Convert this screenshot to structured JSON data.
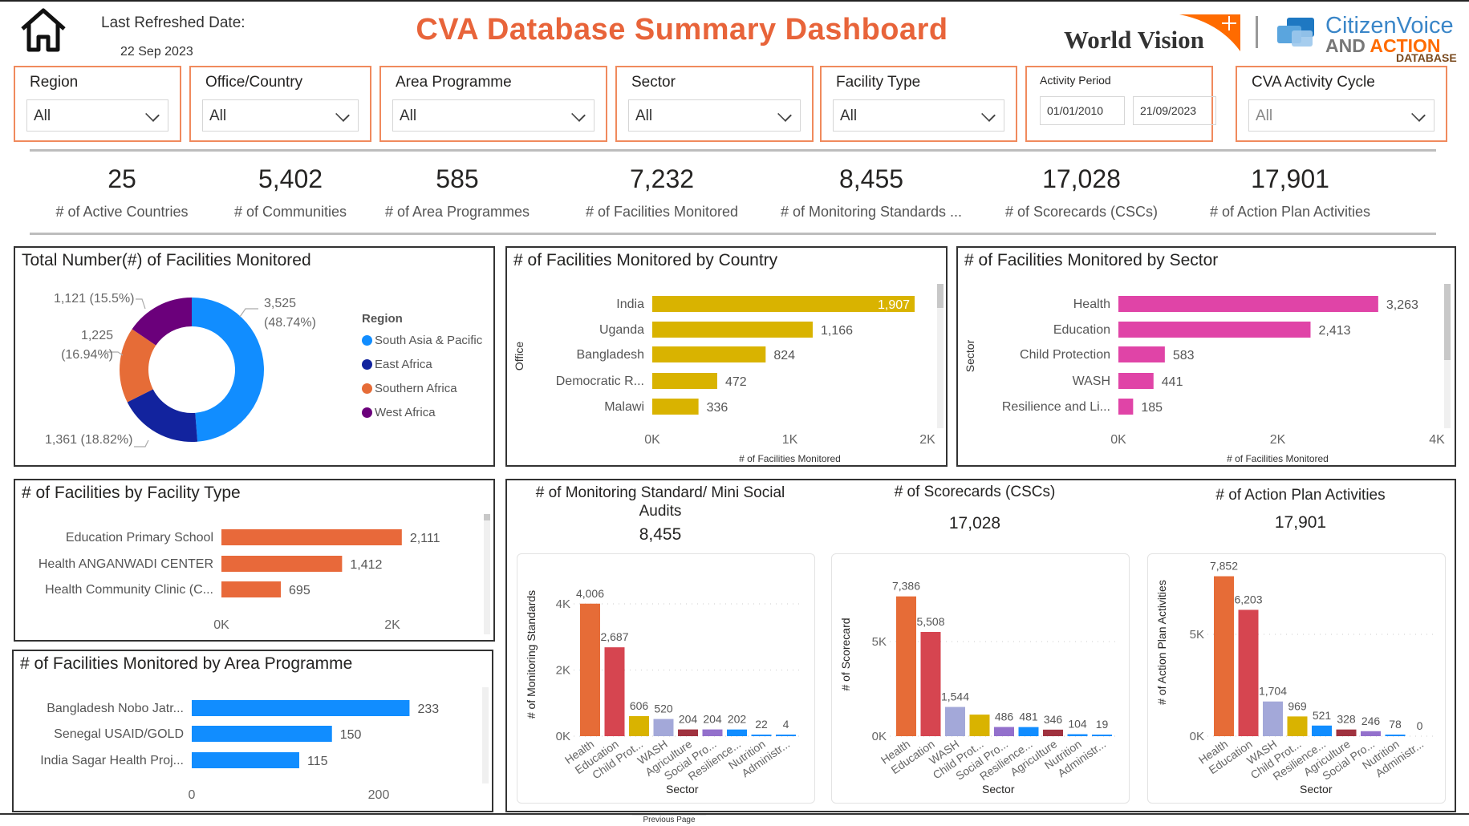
{
  "header": {
    "refresh_label": "Last Refreshed Date:",
    "refresh_date": "22 Sep 2023",
    "title": "CVA Database Summary Dashboard",
    "logo_wv": "World Vision",
    "logo_cva_1": "CitizenVoice",
    "logo_cva_2a": "AND ",
    "logo_cva_2b": "ACTION",
    "logo_cva_3": "DATABASE",
    "home_icon": "home-icon"
  },
  "filters": [
    {
      "label": "Region",
      "value": "All"
    },
    {
      "label": "Office/Country",
      "value": "All"
    },
    {
      "label": "Area Programme",
      "value": "All"
    },
    {
      "label": "Sector",
      "value": "All"
    },
    {
      "label": "Facility Type",
      "value": "All"
    }
  ],
  "activity_period": {
    "label": "Activity Period",
    "start": "01/01/2010",
    "end": "21/09/2023"
  },
  "cycle_filter": {
    "label": "CVA Activity Cycle",
    "value": "All"
  },
  "kpis": [
    {
      "value": "25",
      "label": "# of Active Countries"
    },
    {
      "value": "5,402",
      "label": "# of Communities"
    },
    {
      "value": "585",
      "label": "# of Area Programmes"
    },
    {
      "value": "7,232",
      "label": "# of Facilities Monitored"
    },
    {
      "value": "8,455",
      "label": "# of Monitoring Standards ..."
    },
    {
      "value": "17,028",
      "label": "# of Scorecards (CSCs)"
    },
    {
      "value": "17,901",
      "label": "# of Action Plan Activities"
    }
  ],
  "colors": {
    "accent": "#E8643A",
    "filter_border": "#F08A5D"
  },
  "footer": {
    "tab": "Previous Page"
  },
  "chart_data": [
    {
      "id": "donut",
      "type": "pie",
      "title": "Total Number(#) of Facilities Monitored",
      "legend_title": "Region",
      "legend_position": "right",
      "slices": [
        {
          "name": "South Asia & Pacific",
          "value": 3525,
          "pct": 48.74,
          "color": "#118DFF",
          "label1": "3,525",
          "label2": "(48.74%)"
        },
        {
          "name": "East Africa",
          "value": 1361,
          "pct": 18.82,
          "color": "#12239E",
          "label1": "1,361 (18.82%)",
          "label2": ""
        },
        {
          "name": "Southern Africa",
          "value": 1225,
          "pct": 16.94,
          "color": "#E66C37",
          "label1": "1,225",
          "label2": "(16.94%)"
        },
        {
          "name": "West Africa",
          "value": 1121,
          "pct": 15.5,
          "color": "#6B007B",
          "label1": "1,121 (15.5%)",
          "label2": ""
        }
      ]
    },
    {
      "id": "country",
      "type": "bar",
      "orientation": "horizontal",
      "title": "# of Facilities Monitored by Country",
      "ylabel": "Office",
      "xlabel": "# of Facilities Monitored",
      "categories": [
        "India",
        "Uganda",
        "Bangladesh",
        "Democratic R...",
        "Malawi"
      ],
      "values": [
        1907,
        1166,
        824,
        472,
        336
      ],
      "value_labels": [
        "1,907",
        "1,166",
        "824",
        "472",
        "336"
      ],
      "xlim": [
        0,
        2000
      ],
      "xticks": [
        "0K",
        "1K",
        "2K"
      ],
      "color": "#D9B300"
    },
    {
      "id": "sector",
      "type": "bar",
      "orientation": "horizontal",
      "title": "# of Facilities Monitored by Sector",
      "ylabel": "Sector",
      "xlabel": "# of Facilities Monitored",
      "categories": [
        "Health",
        "Education",
        "Child Protection",
        "WASH",
        "Resilience and Li..."
      ],
      "values": [
        3263,
        2413,
        583,
        441,
        185
      ],
      "value_labels": [
        "3,263",
        "2,413",
        "583",
        "441",
        "185"
      ],
      "xlim": [
        0,
        4000
      ],
      "xticks": [
        "0K",
        "2K",
        "4K"
      ],
      "color": "#E044A7"
    },
    {
      "id": "ftype",
      "type": "bar",
      "orientation": "horizontal",
      "title": "# of Facilities by Facility Type",
      "ylabel": "",
      "xlabel": "",
      "categories": [
        "Education Primary School",
        "Health ANGANWADI CENTER",
        "Health Community Clinic (C..."
      ],
      "values": [
        2111,
        1412,
        695
      ],
      "value_labels": [
        "2,111",
        "1,412",
        "695"
      ],
      "xlim": [
        0,
        2000
      ],
      "xticks": [
        "0K",
        "2K"
      ],
      "color": "#E8693A"
    },
    {
      "id": "ap",
      "type": "bar",
      "orientation": "horizontal",
      "title": "# of Facilities Monitored by Area Programme",
      "ylabel": "",
      "xlabel": "",
      "categories": [
        "Bangladesh Nobo Jatr...",
        "Senegal USAID/GOLD",
        "India Sagar Health Proj..."
      ],
      "values": [
        233,
        150,
        115
      ],
      "value_labels": [
        "233",
        "150",
        "115"
      ],
      "xlim": [
        0,
        200
      ],
      "xticks": [
        "0",
        "200"
      ],
      "color": "#118DFF"
    },
    {
      "id": "ms",
      "type": "bar",
      "orientation": "vertical",
      "title": "# of Monitoring Standard/ Mini Social Audits",
      "total": "8,455",
      "ylabel": "# of Monitoring Standards",
      "xlabel": "Sector",
      "categories": [
        "Health",
        "Education",
        "Child Prot...",
        "WASH",
        "Agriculture",
        "Social Pro...",
        "Resilience...",
        "Nutrition",
        "Administr..."
      ],
      "values": [
        4006,
        2687,
        606,
        520,
        204,
        204,
        202,
        22,
        4
      ],
      "value_labels": [
        "4,006",
        "2,687",
        "606",
        "520",
        "204",
        "204",
        "202",
        "22",
        "4"
      ],
      "colors": [
        "#E66C37",
        "#D64550",
        "#D9B300",
        "#A3A8D9",
        "#A0323F",
        "#9370CC",
        "#118DFF",
        "#118DFF",
        "#118DFF"
      ],
      "ylim": [
        0,
        4000
      ],
      "yticks": [
        {
          "v": 0,
          "t": "0K"
        },
        {
          "v": 2000,
          "t": "2K"
        },
        {
          "v": 4000,
          "t": "4K"
        }
      ],
      "grid": true
    },
    {
      "id": "sc",
      "type": "bar",
      "orientation": "vertical",
      "title": "# of Scorecards (CSCs)",
      "total": "17,028",
      "ylabel": "# of Scorecard",
      "xlabel": "Sector",
      "categories": [
        "Health",
        "Education",
        "WASH",
        "Child Prot...",
        "Social Pro...",
        "Resilience...",
        "Agriculture",
        "Nutrition",
        "Administr..."
      ],
      "values": [
        7386,
        5508,
        1544,
        1140,
        486,
        481,
        346,
        104,
        19
      ],
      "value_labels": [
        "7,386",
        "5,508",
        "1,544",
        "",
        "486",
        "481",
        "346",
        "104",
        "19"
      ],
      "colors": [
        "#E66C37",
        "#D64550",
        "#A3A8D9",
        "#D9B300",
        "#9370CC",
        "#118DFF",
        "#A0323F",
        "#118DFF",
        "#118DFF"
      ],
      "ylim": [
        0,
        5000
      ],
      "yticks": [
        {
          "v": 0,
          "t": "0K"
        },
        {
          "v": 5000,
          "t": "5K"
        }
      ],
      "grid": true
    },
    {
      "id": "ap2",
      "type": "bar",
      "orientation": "vertical",
      "title": "# of Action Plan Activities",
      "total": "17,901",
      "ylabel": "# of Action Plan Activities",
      "xlabel": "Sector",
      "categories": [
        "Health",
        "Education",
        "WASH",
        "Child Prot...",
        "Resilience...",
        "Agriculture",
        "Social Pro...",
        "Nutrition",
        "Administr..."
      ],
      "values": [
        7852,
        6203,
        1704,
        969,
        521,
        328,
        246,
        78,
        0
      ],
      "value_labels": [
        "7,852",
        "6,203",
        "1,704",
        "969",
        "521",
        "328",
        "246",
        "78",
        "0"
      ],
      "colors": [
        "#E66C37",
        "#D64550",
        "#A3A8D9",
        "#D9B300",
        "#118DFF",
        "#A0323F",
        "#9370CC",
        "#118DFF",
        "#118DFF"
      ],
      "ylim": [
        0,
        5000
      ],
      "yticks": [
        {
          "v": 0,
          "t": "0K"
        },
        {
          "v": 5000,
          "t": "5K"
        }
      ],
      "grid": true
    }
  ]
}
